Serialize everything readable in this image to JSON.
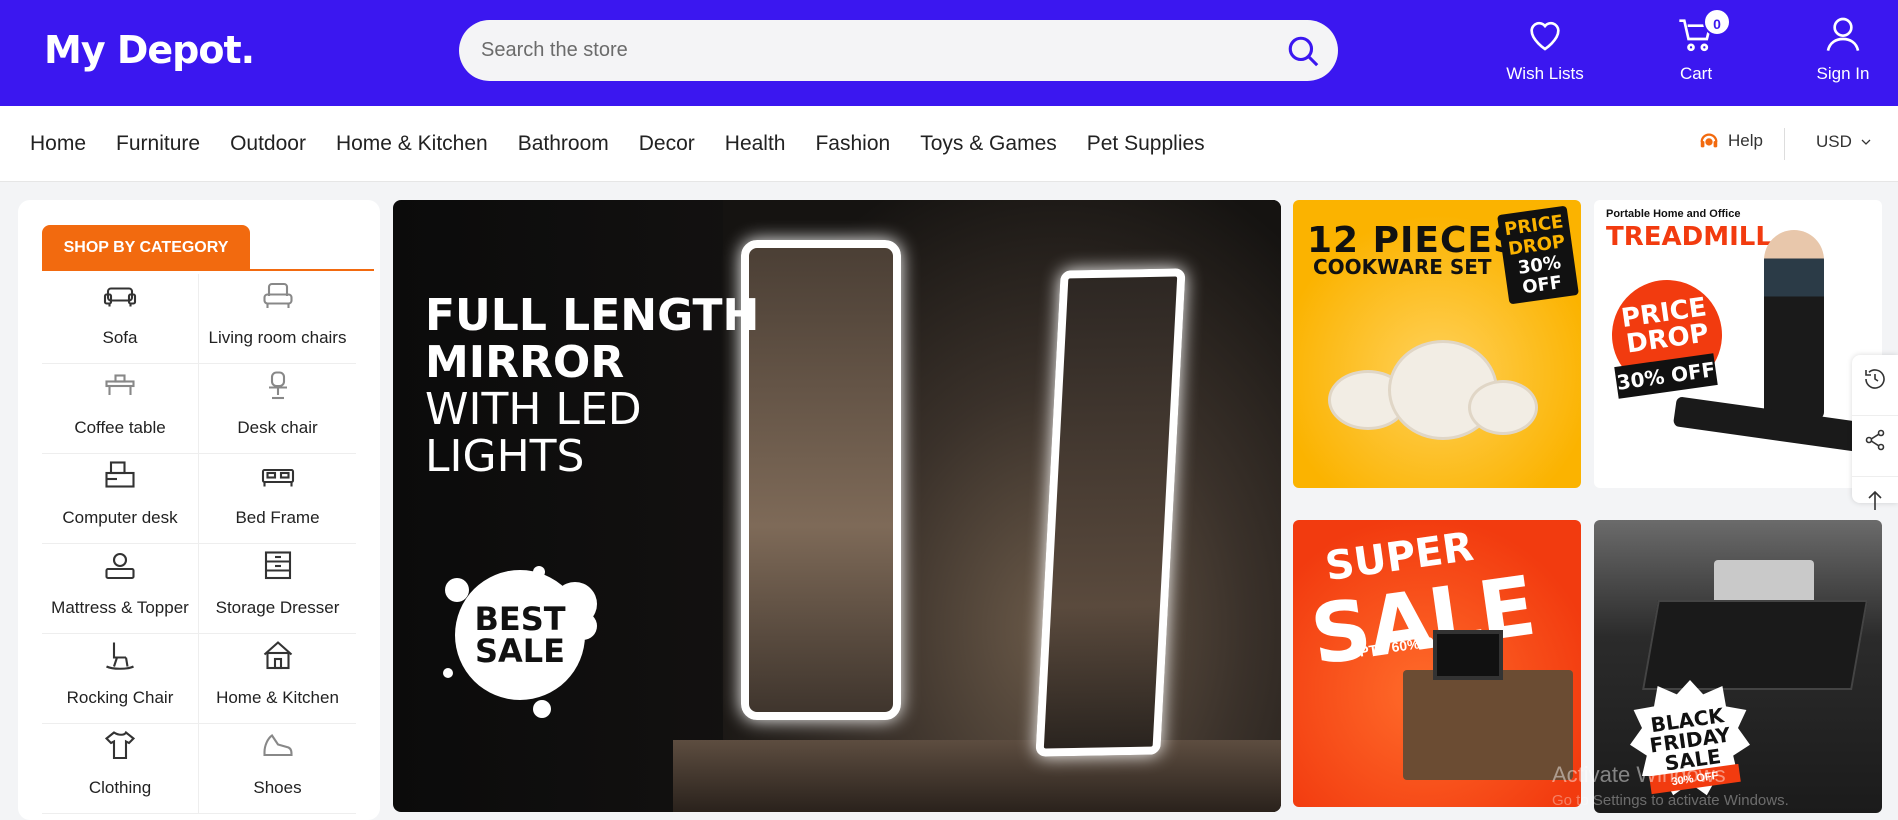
{
  "header": {
    "logo": "My Depot",
    "logo_dot": ".",
    "search_placeholder": "Search the store",
    "wishlist_label": "Wish Lists",
    "cart_label": "Cart",
    "cart_count": "0",
    "signin_label": "Sign In",
    "accent_color": "#3b17f0"
  },
  "nav": {
    "items": [
      "Home",
      "Furniture",
      "Outdoor",
      "Home & Kitchen",
      "Bathroom",
      "Decor",
      "Health",
      "Fashion",
      "Toys & Games",
      "Pet Supplies"
    ],
    "help_label": "Help",
    "currency": "USD"
  },
  "sidebar": {
    "title": "SHOP BY CATEGORY",
    "title_color": "#f26a0f",
    "categories": [
      {
        "label": "Sofa",
        "icon": "sofa-icon"
      },
      {
        "label": "Living room chairs",
        "icon": "armchair-icon"
      },
      {
        "label": "Coffee table",
        "icon": "coffee-table-icon"
      },
      {
        "label": "Desk chair",
        "icon": "desk-chair-icon"
      },
      {
        "label": "Computer desk",
        "icon": "computer-desk-icon"
      },
      {
        "label": "Bed Frame",
        "icon": "bed-frame-icon"
      },
      {
        "label": "Mattress & Topper",
        "icon": "mattress-icon"
      },
      {
        "label": "Storage Dresser",
        "icon": "dresser-icon"
      },
      {
        "label": "Rocking Chair",
        "icon": "rocking-chair-icon"
      },
      {
        "label": "Home & Kitchen",
        "icon": "home-icon"
      },
      {
        "label": "Clothing",
        "icon": "clothing-icon"
      },
      {
        "label": "Shoes",
        "icon": "shoes-icon"
      }
    ]
  },
  "hero": {
    "line1": "FULL LENGTH",
    "line2": "MIRROR",
    "line3": "WITH LED",
    "line4": "LIGHTS",
    "badge_line1": "BEST",
    "badge_line2": "SALE"
  },
  "promos": {
    "cookware_title": "12 PIECES",
    "cookware_sub": "COOKWARE SET",
    "price_drop_1": "PRICE DROP",
    "price_drop_1_off": "30% OFF",
    "treadmill_small": "Portable Home and Office",
    "treadmill_title": "TREADMILL",
    "treadmill_drop": "PRICE DROP",
    "treadmill_off": "30% OFF",
    "super": "SUPER",
    "sale": "SALE",
    "upto": "UPTO 60% OFF",
    "bf_text": "BLACK FRIDAY SALE",
    "bf_off": "30% OFF"
  },
  "watermark": {
    "line1": "Activate Windows",
    "line2": "Go to Settings to activate Windows."
  }
}
